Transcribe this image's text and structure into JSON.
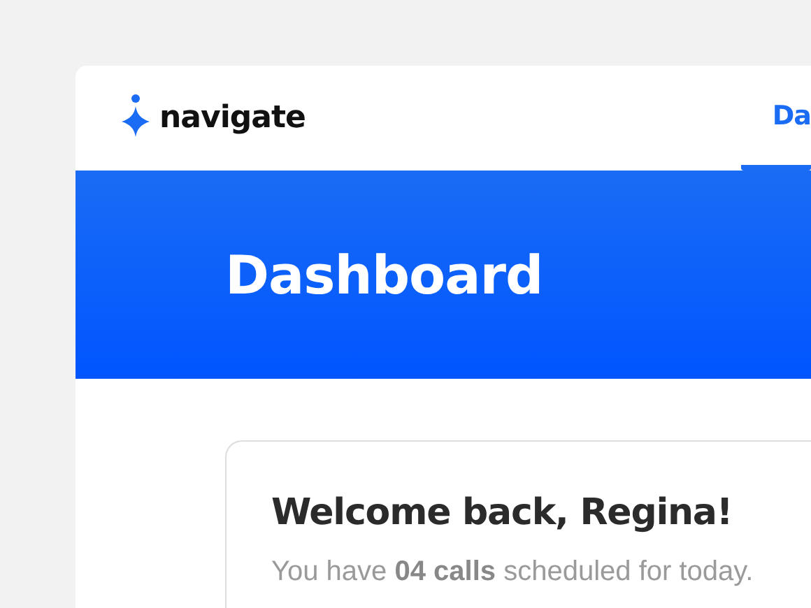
{
  "header": {
    "logo_text": "navigate",
    "tabs": [
      {
        "label": "Da",
        "selected": true
      }
    ]
  },
  "banner": {
    "title": "Dashboard"
  },
  "welcome_card": {
    "title": "Welcome back, Regina!",
    "message": "You have **04 calls** scheduled for today."
  }
}
